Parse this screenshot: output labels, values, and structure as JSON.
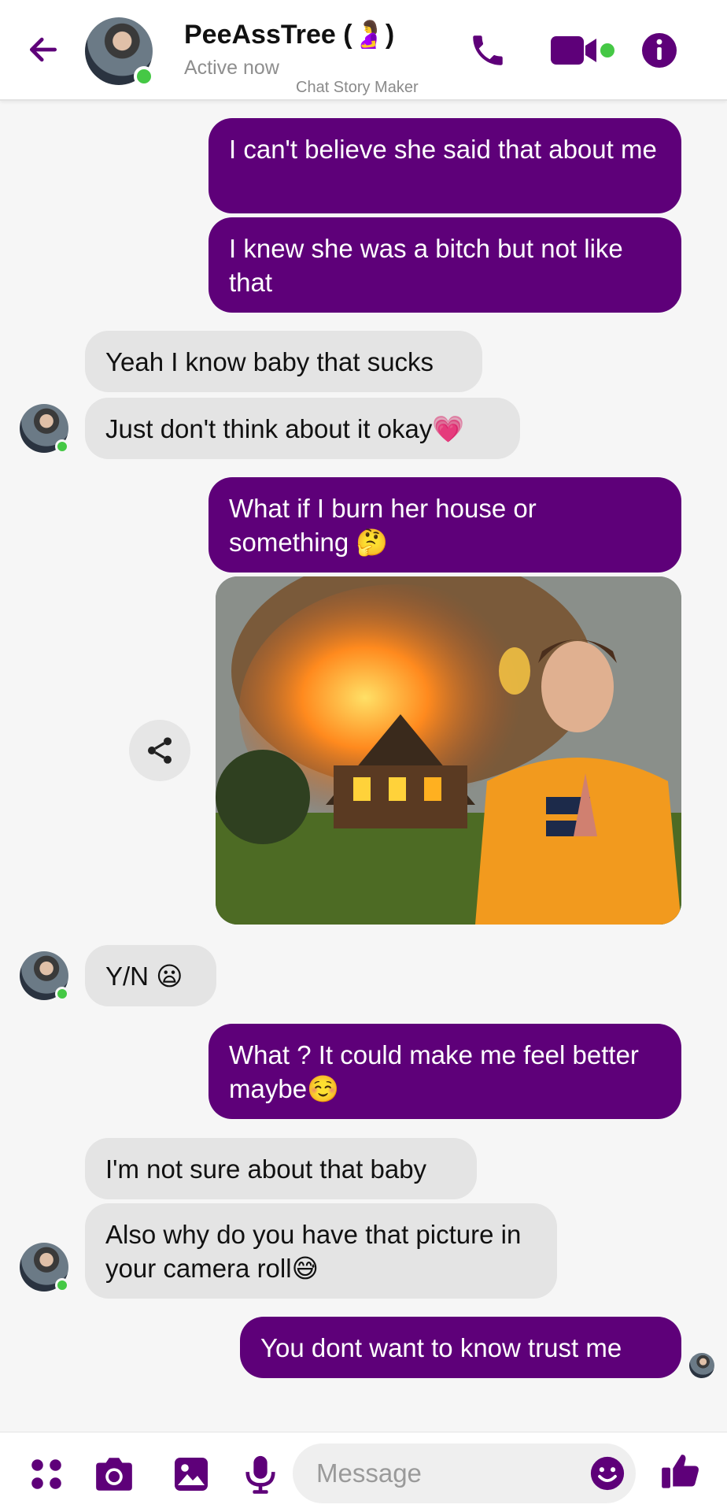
{
  "header": {
    "contact_name": "PeeAssTree (🤰)",
    "status": "Active now",
    "watermark": "Chat Story Maker"
  },
  "colors": {
    "accent": "#5e0079",
    "incoming_bubble": "#e4e4e4",
    "online": "#45c845"
  },
  "messages": [
    {
      "dir": "out",
      "text": "I can't believe she said that about me"
    },
    {
      "dir": "out",
      "text": "I knew she was a bitch but not like that"
    },
    {
      "dir": "in",
      "text": "Yeah I know baby that sucks"
    },
    {
      "dir": "in",
      "text": "Just don't think about it okay💗"
    },
    {
      "dir": "out",
      "text": "What if I burn her house or something 🤔"
    },
    {
      "dir": "out",
      "type": "image"
    },
    {
      "dir": "in",
      "text": "Y/N 😦"
    },
    {
      "dir": "out",
      "text": "What ? It could make me feel better maybe☺️"
    },
    {
      "dir": "in",
      "text": "I'm not sure about that baby"
    },
    {
      "dir": "in",
      "text": "Also why do you have that picture in your camera roll😅"
    },
    {
      "dir": "out",
      "text": "You dont want to know trust me"
    }
  ],
  "composer": {
    "placeholder": "Message"
  },
  "icons": {
    "back": "arrow-left-icon",
    "call": "phone-icon",
    "video": "video-camera-icon",
    "info": "info-icon",
    "share": "share-icon",
    "apps": "apps-grid-icon",
    "camera": "camera-icon",
    "gallery": "gallery-icon",
    "mic": "microphone-icon",
    "emoji": "emoji-icon",
    "like": "thumbs-up-icon"
  }
}
